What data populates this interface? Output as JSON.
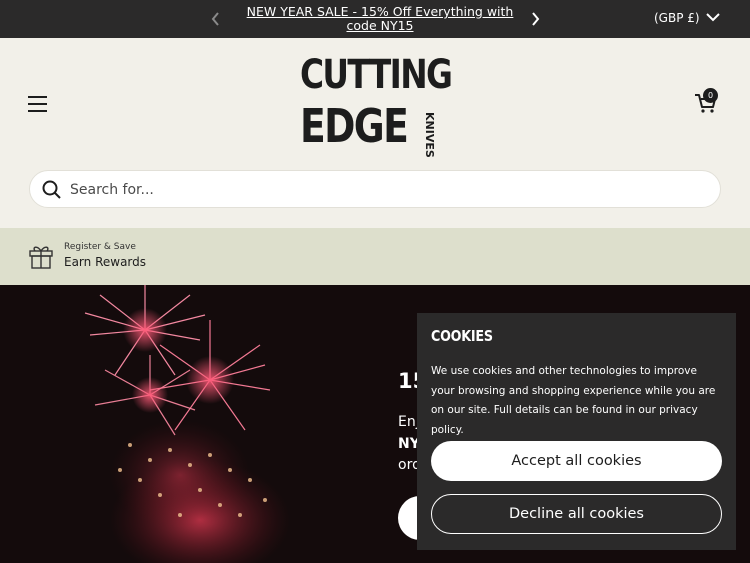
{
  "announcement": {
    "message": "NEW YEAR SALE - 15% Off Everything with code NY15",
    "currency": "(GBP £)",
    "icons": {
      "prev": "chevron-left-icon",
      "next": "chevron-right-icon",
      "currency_dropdown": "chevron-down-icon"
    }
  },
  "header": {
    "logo": {
      "line1": "CUTTING",
      "line2": "EDGE",
      "line3": "KNIVES"
    },
    "cart_count": "0",
    "icons": {
      "menu": "hamburger-menu-icon",
      "cart": "shopping-cart-icon"
    }
  },
  "search": {
    "placeholder": "Search for...",
    "icon": "search-icon"
  },
  "rewards": {
    "subtitle": "Register & Save",
    "title": "Earn Rewards",
    "icon": "gift-icon"
  },
  "hero": {
    "title": "15",
    "line1": "Enj",
    "line2": "NY",
    "line3": "ord"
  },
  "cookies": {
    "title": "COOKIES",
    "body": "We use cookies and other technologies to improve your browsing and shopping experience while you are on our site. Full details can be found in our privacy policy.",
    "accept_label": "Accept all cookies",
    "decline_label": "Decline all cookies"
  },
  "colors": {
    "dark": "#2b2a2a",
    "cream": "#f2f0e9",
    "rewards_bg": "#dddfcc",
    "hero_bg": "#140b0c"
  }
}
